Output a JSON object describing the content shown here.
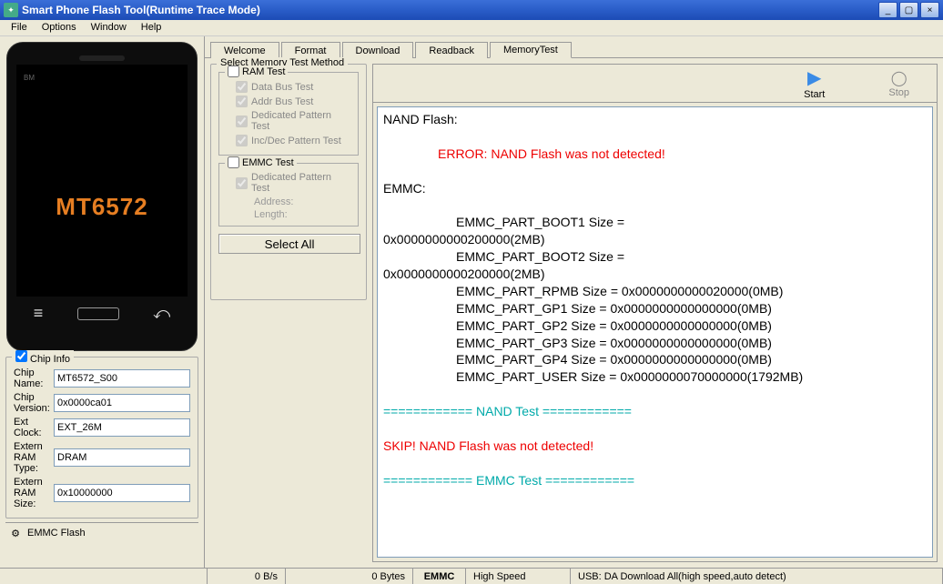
{
  "titlebar": {
    "title": "Smart Phone Flash Tool(Runtime Trace Mode)"
  },
  "menu": {
    "file": "File",
    "options": "Options",
    "window": "Window",
    "help": "Help"
  },
  "phone": {
    "brand": "BM",
    "label": "MT6572"
  },
  "tabs": {
    "welcome": "Welcome",
    "format": "Format",
    "download": "Download",
    "readback": "Readback",
    "memorytest": "MemoryTest"
  },
  "method": {
    "legend": "Select Memory Test Method",
    "ram_legend": "RAM Test",
    "data_bus": "Data Bus Test",
    "addr_bus": "Addr Bus Test",
    "dedicated": "Dedicated Pattern Test",
    "incdec": "Inc/Dec Pattern Test",
    "emmc_legend": "EMMC Test",
    "emmc_dedicated": "Dedicated Pattern Test",
    "address": "Address:",
    "length": "Length:",
    "select_all": "Select All"
  },
  "toolbar": {
    "start": "Start",
    "stop": "Stop"
  },
  "chipinfo": {
    "legend": "Chip Info",
    "chipname_lbl": "Chip Name:",
    "chipname": "MT6572_S00",
    "chipver_lbl": "Chip Version:",
    "chipver": "0x0000ca01",
    "extclock_lbl": "Ext Clock:",
    "extclock": "EXT_26M",
    "ramtype_lbl": "Extern RAM Type:",
    "ramtype": "DRAM",
    "ramsize_lbl": "Extern RAM Size:",
    "ramsize": "0x10000000"
  },
  "emmcflash": {
    "label": "EMMC Flash"
  },
  "log": {
    "nand_header": "NAND Flash:",
    "nand_error": "ERROR: NAND Flash was not detected!",
    "emmc_header": "EMMC:",
    "boot1": "EMMC_PART_BOOT1              Size =",
    "boot1_val": "0x0000000000200000(2MB)",
    "boot2": "EMMC_PART_BOOT2              Size =",
    "boot2_val": "0x0000000000200000(2MB)",
    "rpmb": "EMMC_PART_RPMB    Size = 0x0000000000020000(0MB)",
    "gp1": "EMMC_PART_GP1      Size = 0x0000000000000000(0MB)",
    "gp2": "EMMC_PART_GP2      Size = 0x0000000000000000(0MB)",
    "gp3": "EMMC_PART_GP3      Size = 0x0000000000000000(0MB)",
    "gp4": "EMMC_PART_GP4      Size = 0x0000000000000000(0MB)",
    "user": "EMMC_PART_USER   Size = 0x0000000070000000(1792MB)",
    "nand_test_title": "============      NAND Test             ============",
    "nand_skip": "SKIP! NAND Flash was not detected!",
    "emmc_test_title": "============      EMMC Test             ============"
  },
  "status": {
    "bps": "0 B/s",
    "bytes": "0 Bytes",
    "emmc": "EMMC",
    "speed": "High Speed",
    "usb": "USB: DA Download All(high speed,auto detect)"
  }
}
